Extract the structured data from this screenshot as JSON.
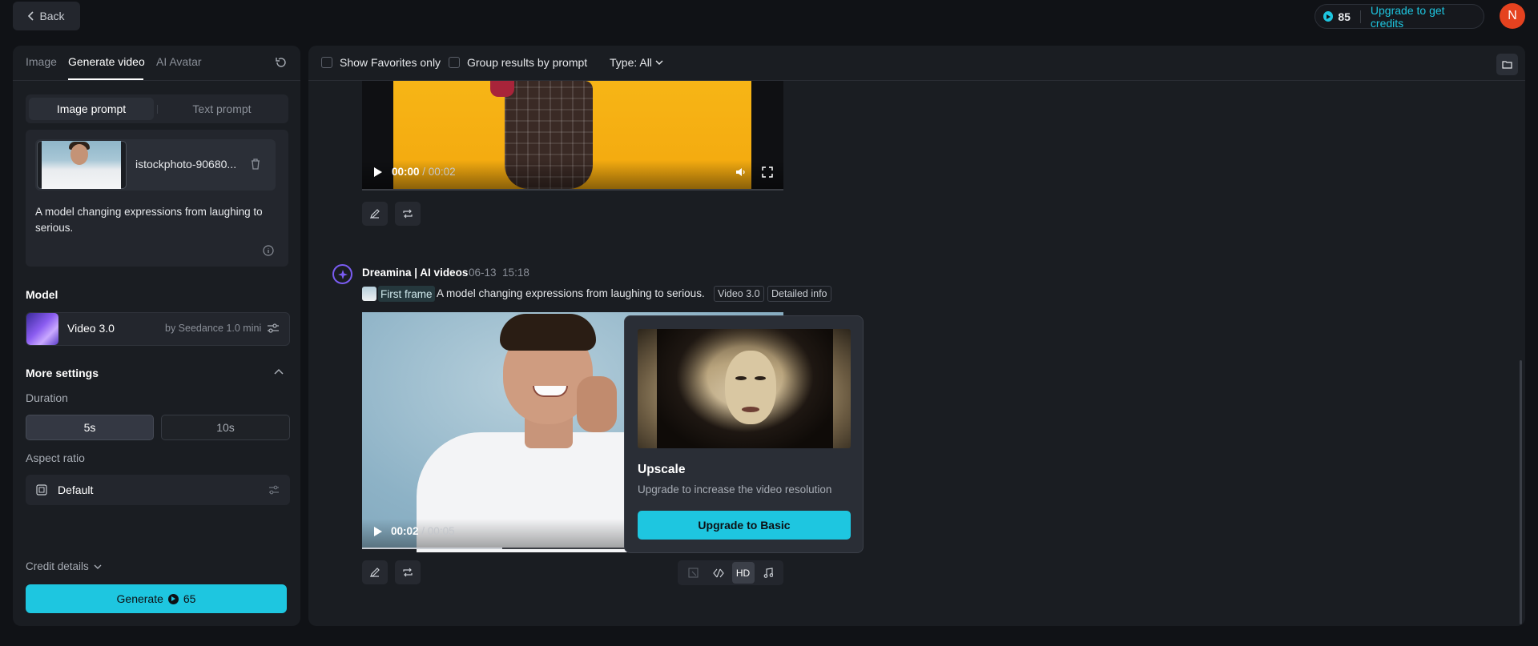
{
  "topbar": {
    "back_label": "Back",
    "credits": "85",
    "upgrade_label": "Upgrade to get credits",
    "avatar_initial": "N"
  },
  "left": {
    "tabs": [
      "Image",
      "Generate video",
      "AI Avatar"
    ],
    "prompt_modes": [
      "Image prompt",
      "Text prompt"
    ],
    "file_name": "istockphoto-90680...",
    "prompt_text": "A model changing expressions from laughing to serious.",
    "model_heading": "Model",
    "model_name": "Video 3.0",
    "model_by": "by Seedance 1.0 mini",
    "more_settings": "More settings",
    "duration_label": "Duration",
    "duration_options": [
      "5s",
      "10s"
    ],
    "aspect_label": "Aspect ratio",
    "aspect_value": "Default",
    "credit_details": "Credit details",
    "generate_label": "Generate",
    "generate_cost": "65"
  },
  "filters": {
    "favorites": "Show Favorites only",
    "group": "Group results by prompt",
    "type": "Type: All"
  },
  "video1": {
    "time_current": "00:00",
    "time_total": "/ 00:02"
  },
  "entry2": {
    "brand": "Dreamina | AI videos",
    "date": "06-13",
    "time": "15:18",
    "first_frame": "First frame",
    "prompt": "A model changing expressions from laughing to serious.",
    "tags": [
      "Video 3.0",
      "Detailed info"
    ],
    "time_current": "00:02",
    "time_total": "/ 00:05",
    "hd_label": "HD"
  },
  "popup": {
    "title": "Upscale",
    "description": "Upgrade to increase the video resolution",
    "button": "Upgrade to Basic"
  },
  "colors": {
    "accent": "#1ec6e0",
    "background": "#101216",
    "panel": "#1a1d22",
    "avatar": "#e5421f"
  }
}
